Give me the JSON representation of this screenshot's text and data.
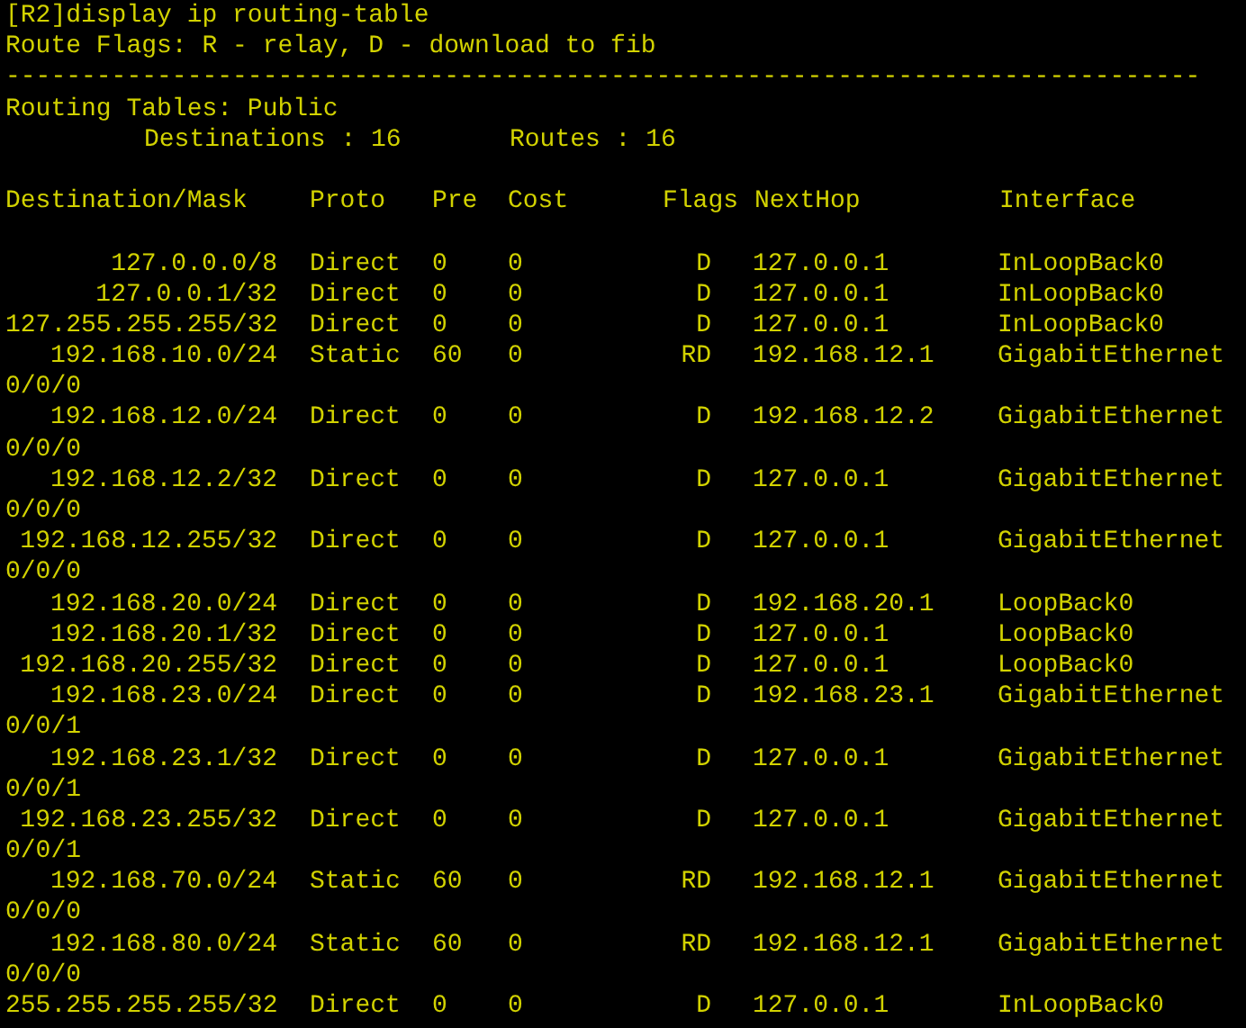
{
  "command": "[R2]display ip routing-table",
  "legend": "Route Flags: R - relay, D - download to fib",
  "separator": "-------------------------------------------------------------------------------",
  "tables_title": "Routing Tables: Public",
  "summary": {
    "destinations": "Destinations : 16",
    "routes": "Routes : 16"
  },
  "columns": [
    "Destination/Mask",
    "Proto",
    "Pre",
    "Cost",
    "Flags",
    "NextHop",
    "Interface"
  ],
  "rows": [
    {
      "destination": "127.0.0.0/8",
      "proto": "Direct",
      "pre": "0",
      "cost": "0",
      "flags": "D",
      "nexthop": "127.0.0.1",
      "interface": "InLoopBack0"
    },
    {
      "destination": "127.0.0.1/32",
      "proto": "Direct",
      "pre": "0",
      "cost": "0",
      "flags": "D",
      "nexthop": "127.0.0.1",
      "interface": "InLoopBack0"
    },
    {
      "destination": "127.255.255.255/32",
      "proto": "Direct",
      "pre": "0",
      "cost": "0",
      "flags": "D",
      "nexthop": "127.0.0.1",
      "interface": "InLoopBack0"
    },
    {
      "destination": "192.168.10.0/24",
      "proto": "Static",
      "pre": "60",
      "cost": "0",
      "flags": "RD",
      "nexthop": "192.168.12.1",
      "interface": "GigabitEthernet",
      "interface_wrap": "0/0/0"
    },
    {
      "destination": "192.168.12.0/24",
      "proto": "Direct",
      "pre": "0",
      "cost": "0",
      "flags": "D",
      "nexthop": "192.168.12.2",
      "interface": "GigabitEthernet",
      "interface_wrap": "0/0/0"
    },
    {
      "destination": "192.168.12.2/32",
      "proto": "Direct",
      "pre": "0",
      "cost": "0",
      "flags": "D",
      "nexthop": "127.0.0.1",
      "interface": "GigabitEthernet",
      "interface_wrap": "0/0/0"
    },
    {
      "destination": "192.168.12.255/32",
      "proto": "Direct",
      "pre": "0",
      "cost": "0",
      "flags": "D",
      "nexthop": "127.0.0.1",
      "interface": "GigabitEthernet",
      "interface_wrap": "0/0/0"
    },
    {
      "destination": "192.168.20.0/24",
      "proto": "Direct",
      "pre": "0",
      "cost": "0",
      "flags": "D",
      "nexthop": "192.168.20.1",
      "interface": "LoopBack0"
    },
    {
      "destination": "192.168.20.1/32",
      "proto": "Direct",
      "pre": "0",
      "cost": "0",
      "flags": "D",
      "nexthop": "127.0.0.1",
      "interface": "LoopBack0"
    },
    {
      "destination": "192.168.20.255/32",
      "proto": "Direct",
      "pre": "0",
      "cost": "0",
      "flags": "D",
      "nexthop": "127.0.0.1",
      "interface": "LoopBack0"
    },
    {
      "destination": "192.168.23.0/24",
      "proto": "Direct",
      "pre": "0",
      "cost": "0",
      "flags": "D",
      "nexthop": "192.168.23.1",
      "interface": "GigabitEthernet",
      "interface_wrap": "0/0/1"
    },
    {
      "destination": "192.168.23.1/32",
      "proto": "Direct",
      "pre": "0",
      "cost": "0",
      "flags": "D",
      "nexthop": "127.0.0.1",
      "interface": "GigabitEthernet",
      "interface_wrap": "0/0/1"
    },
    {
      "destination": "192.168.23.255/32",
      "proto": "Direct",
      "pre": "0",
      "cost": "0",
      "flags": "D",
      "nexthop": "127.0.0.1",
      "interface": "GigabitEthernet",
      "interface_wrap": "0/0/1"
    },
    {
      "destination": "192.168.70.0/24",
      "proto": "Static",
      "pre": "60",
      "cost": "0",
      "flags": "RD",
      "nexthop": "192.168.12.1",
      "interface": "GigabitEthernet",
      "interface_wrap": "0/0/0"
    },
    {
      "destination": "192.168.80.0/24",
      "proto": "Static",
      "pre": "60",
      "cost": "0",
      "flags": "RD",
      "nexthop": "192.168.12.1",
      "interface": "GigabitEthernet",
      "interface_wrap": "0/0/0"
    },
    {
      "destination": "255.255.255.255/32",
      "proto": "Direct",
      "pre": "0",
      "cost": "0",
      "flags": "D",
      "nexthop": "127.0.0.1",
      "interface": "InLoopBack0"
    }
  ]
}
